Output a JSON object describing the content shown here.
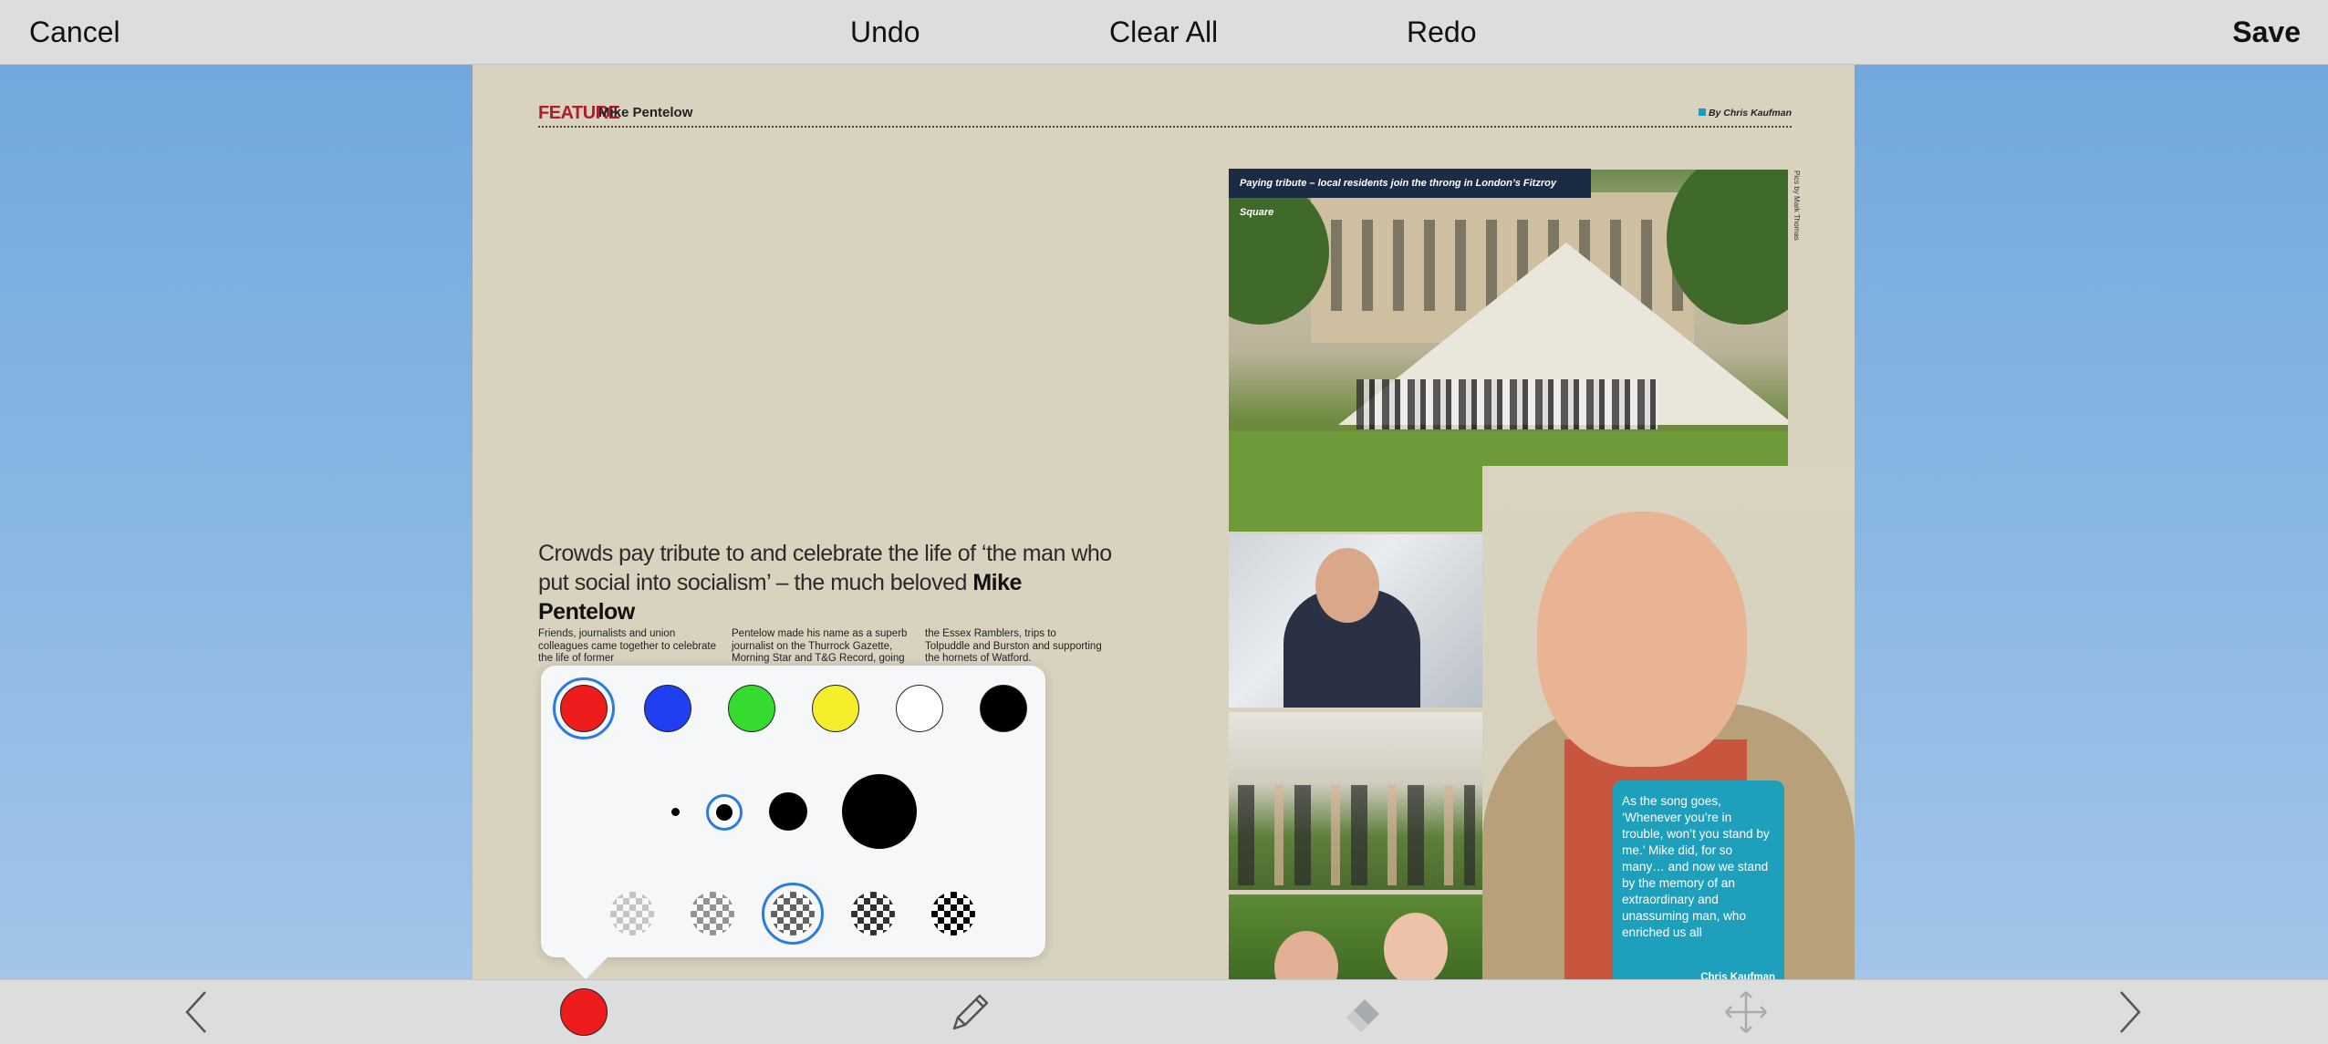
{
  "toolbar": {
    "cancel": "Cancel",
    "undo": "Undo",
    "clear_all": "Clear All",
    "redo": "Redo",
    "save": "Save"
  },
  "article": {
    "section": "FEATURE",
    "subject": "Mike Pentelow",
    "byline": "By Chris Kaufman",
    "headline_lead": "Crowds pay tribute to and celebrate the life of ‘the man who put social into socialism’ – the much beloved",
    "headline_name": "Mike Pentelow",
    "columns": [
      "Friends, journalists and union colleagues came together to celebrate the life of former",
      "Pentelow made his name as a superb journalist on the Thurrock Gazette, Morning Star and T&G Record, going",
      "the Essex Ramblers, trips to Tolpuddle and Burston and supporting the hornets of Watford."
    ],
    "photo_caption": "Paying tribute – local residents join the throng in London’s Fitzroy Square",
    "photo_credit": "Pics by Mark Thomas",
    "quote": "As the song goes, ‘Whenever you’re in trouble, won’t you stand by me.’ Mike did, for so many… and now we stand by the memory of an extraordinary and unassuming man, who enriched us all",
    "quote_author": "Chris Kaufman"
  },
  "brush": {
    "colors": [
      "#ee1c1c",
      "#1f3ff0",
      "#35dc2f",
      "#f5ee2b",
      "#ffffff",
      "#000000"
    ],
    "selected_color": "#ee1c1c",
    "sizes": [
      "extra-small",
      "small",
      "medium",
      "large"
    ],
    "selected_size": "small",
    "opacity_levels": [
      0.2,
      0.4,
      0.6,
      0.8,
      1.0
    ],
    "selected_opacity": 0.6
  },
  "bottom_tools": [
    "back-chevron-icon",
    "color-picker",
    "pencil-icon",
    "eraser-icon",
    "move-icon",
    "forward-chevron-icon"
  ]
}
